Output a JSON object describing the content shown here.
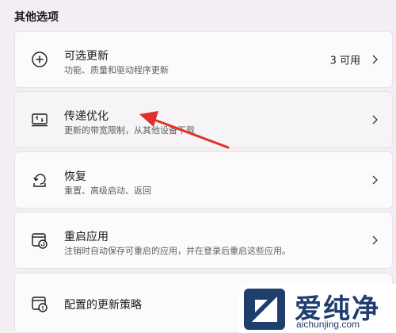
{
  "section": {
    "title": "其他选项"
  },
  "items": [
    {
      "title": "可选更新",
      "subtitle": "功能、质量和驱动程序更新",
      "meta": "3 可用",
      "icon": "plus-circle-icon"
    },
    {
      "title": "传递优化",
      "subtitle": "更新的带宽限制，从其他设备下载",
      "meta": "",
      "icon": "delivery-optimization-icon"
    },
    {
      "title": "恢复",
      "subtitle": "重置、高级启动、返回",
      "meta": "",
      "icon": "recovery-icon"
    },
    {
      "title": "重启应用",
      "subtitle": "注销时自动保存可重启的应用，并在登录后重启这些应用。",
      "meta": "",
      "icon": "restart-apps-icon"
    },
    {
      "title": "配置的更新策略",
      "subtitle": "",
      "meta": "",
      "icon": "update-policy-icon"
    }
  ],
  "annotation": {
    "color": "#e0322a"
  },
  "watermark": {
    "brand": "爱纯净",
    "url": "aichunjing.com"
  }
}
